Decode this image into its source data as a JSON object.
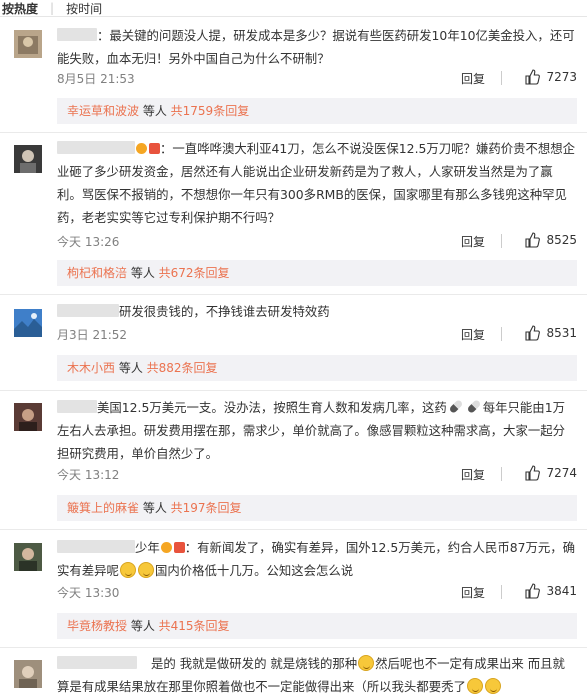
{
  "sort": {
    "hot_label": "按热度",
    "time_label": "按时间"
  },
  "icons": {
    "like": "thumbs-up-icon"
  },
  "colors": {
    "link": "#eb7350",
    "sub_bg": "#f2f2f5",
    "meta": "#808080"
  },
  "comments": [
    {
      "text": "：最关键的问题没人提，研发成本是多少？据说有些医药研发10年10亿美金投入，还可能失败，血本无归！另外中国自己为什么不研制？",
      "time": "8月5日 21:53",
      "reply": "回复",
      "likes": "7273",
      "sub_names": "幸运草和波波",
      "sub_etc": " 等人 ",
      "sub_total": "共1759条回复"
    },
    {
      "text": "：一直哗哗澳大利亚41刀，怎么不说没医保12.5万刀呢？嫌药价贵不想想企业砸了多少研发资金，居然还有人能说出企业研发新药是为了救人，人家研发当然是为了赢利。骂医保不报销的，不想想你一年只有300多RMB的医保，国家哪里有那么多钱兜这种罕见药，老老实实等它过专利保护期不行吗？",
      "time": "今天 13:26",
      "reply": "回复",
      "likes": "8525",
      "sub_names": "枸杞和格涪",
      "sub_etc": " 等人 ",
      "sub_total": "共672条回复"
    },
    {
      "text": "研发很贵钱的，不挣钱谁去研发特效药",
      "time": "月3日 21:52",
      "reply": "回复",
      "likes": "8531",
      "sub_names": "木木小西",
      "sub_etc": " 等人 ",
      "sub_total": "共882条回复"
    },
    {
      "text_a": "美国12.5万美元一支。没办法，按照生育人数和发病几率，这药",
      "text_b": "每年只能由1万左右人去承担。研发费用摆在那，需求少，单价就高了。像感冒颗粒这种需求高，大家一起分担研究费用，单价自然少了。",
      "time": "今天 13:12",
      "reply": "回复",
      "likes": "7274",
      "sub_names": "簸箕上的麻雀",
      "sub_etc": " 等人 ",
      "sub_total": "共197条回复"
    },
    {
      "name_tail": "少年",
      "text_a": "：有新闻发了，确实有差异，国外12.5万美元，约合人民币87万元，确实有差异呢",
      "text_b": "国内价格低十几万。公知这会怎么说",
      "time": "今天 13:30",
      "reply": "回复",
      "likes": "3841",
      "sub_names": "毕竟杨教授",
      "sub_etc": " 等人 ",
      "sub_total": "共415条回复"
    },
    {
      "text_a": "是的 我就是做研发的 就是烧钱的那种",
      "text_b": "然后呢也不一定有成果出来 而且就算是有成果结果放在那里你照着做也不一定能做得出来（所以我头都要秃了"
    }
  ]
}
